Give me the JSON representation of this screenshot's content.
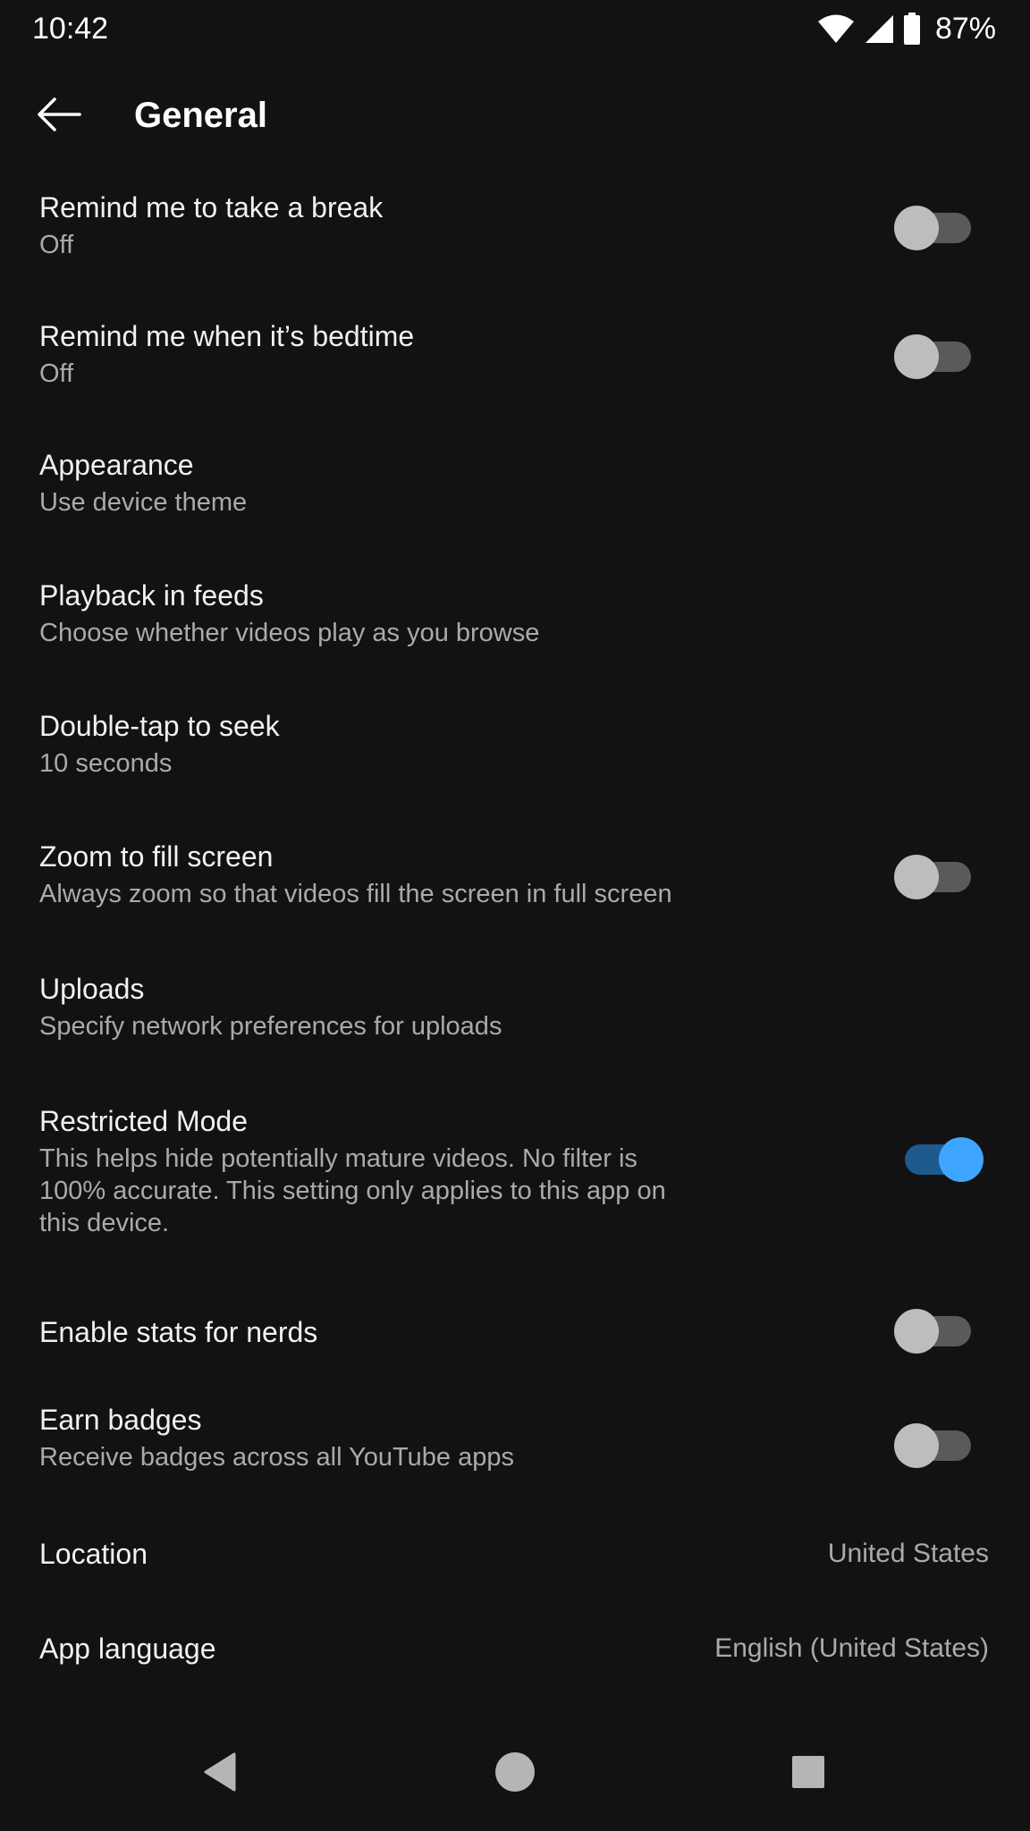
{
  "status_bar": {
    "time": "10:42",
    "battery_percent": "87%",
    "icons": [
      "wifi-icon",
      "cellular-signal-icon",
      "battery-icon"
    ]
  },
  "app_bar": {
    "back_icon": "arrow-left-icon",
    "title": "General"
  },
  "colors": {
    "background": "#121212",
    "text_primary": "#f1f1f1",
    "text_secondary": "#aaaaaa",
    "toggle_on": "#3ea6ff",
    "toggle_off_thumb": "#bdbdbd"
  },
  "settings": [
    {
      "title": "Remind me to take a break",
      "subtitle": "Off",
      "control": "toggle",
      "on": false
    },
    {
      "title": "Remind me when it’s bedtime",
      "subtitle": "Off",
      "control": "toggle",
      "on": false
    },
    {
      "title": "Appearance",
      "subtitle": "Use device theme"
    },
    {
      "title": "Playback in feeds",
      "subtitle": "Choose whether videos play as you browse"
    },
    {
      "title": "Double-tap to seek",
      "subtitle": "10 seconds"
    },
    {
      "title": "Zoom to fill screen",
      "subtitle": "Always zoom so that videos fill the screen in full screen",
      "control": "toggle",
      "on": false
    },
    {
      "title": "Uploads",
      "subtitle": "Specify network preferences for uploads"
    },
    {
      "title": "Restricted Mode",
      "subtitle": "This helps hide potentially mature videos. No filter is 100% accurate. This setting only applies to this app on this device.",
      "control": "toggle",
      "on": true
    },
    {
      "title": "Enable stats for nerds",
      "control": "toggle",
      "on": false
    },
    {
      "title": "Earn badges",
      "subtitle": "Receive badges across all YouTube apps",
      "control": "toggle",
      "on": false
    },
    {
      "title": "Location",
      "value": "United States"
    },
    {
      "title": "App language",
      "value": "English (United States)"
    }
  ],
  "nav_bar": {
    "icons": [
      "nav-back-icon",
      "nav-home-icon",
      "nav-recents-icon"
    ]
  }
}
